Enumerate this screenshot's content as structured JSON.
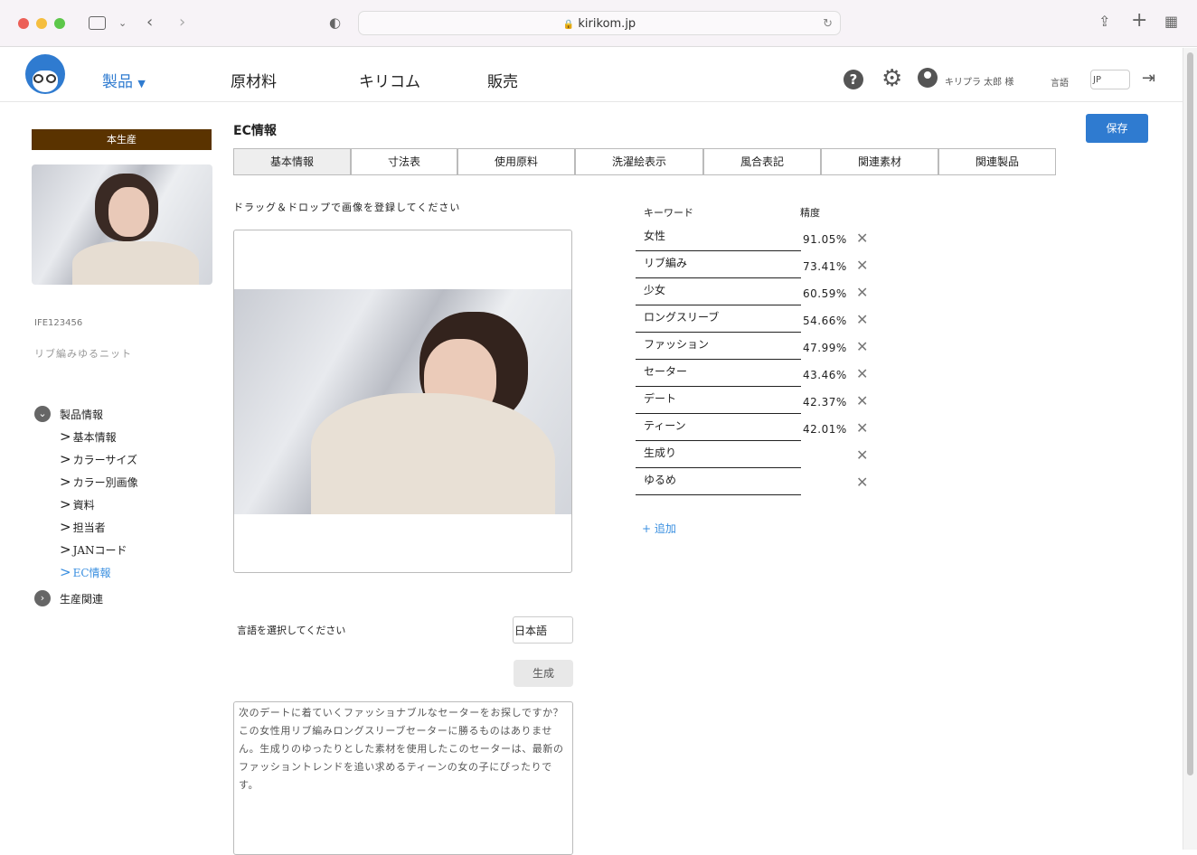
{
  "browser": {
    "url": "kirikom.jp"
  },
  "header": {
    "nav": [
      "製品",
      "原材料",
      "キリコム",
      "販売"
    ],
    "user": "キリプラ 太郎 様",
    "lang_label": "言語",
    "lang_value": "JP"
  },
  "sidebar": {
    "status": "本生産",
    "code": "IFE123456",
    "name": "リブ編みゆるニット",
    "groups": [
      {
        "label": "製品情報",
        "items": [
          "基本情報",
          "カラーサイズ",
          "カラー別画像",
          "資料",
          "担当者",
          "JANコード",
          "EC情報"
        ]
      },
      {
        "label": "生産関連"
      }
    ]
  },
  "main": {
    "title": "EC情報",
    "save": "保存",
    "tabs": [
      "基本情報",
      "寸法表",
      "使用原料",
      "洗濯絵表示",
      "風合表記",
      "関連素材",
      "関連製品"
    ],
    "drop_hint": "ドラッグ＆ドロップで画像を登録してください",
    "lang_prompt": "言語を選択してください",
    "lang_value": "日本語",
    "generate": "生成",
    "description": "次のデートに着ていくファッショナブルなセーターをお探しですか？この女性用リブ編みロングスリーブセーターに勝るものはありません。生成りのゆったりとした素材を使用したこのセーターは、最新のファッショントレンドを追い求めるティーンの女の子にぴったりです。",
    "kw_header": "キーワード",
    "acc_header": "精度",
    "keywords": [
      {
        "k": "女性",
        "p": "91.05%"
      },
      {
        "k": "リブ編み",
        "p": "73.41%"
      },
      {
        "k": "少女",
        "p": "60.59%"
      },
      {
        "k": "ロングスリーブ",
        "p": "54.66%"
      },
      {
        "k": "ファッション",
        "p": "47.99%"
      },
      {
        "k": "セーター",
        "p": "43.46%"
      },
      {
        "k": "デート",
        "p": "42.37%"
      },
      {
        "k": "ティーン",
        "p": "42.01%"
      },
      {
        "k": "生成り",
        "p": ""
      },
      {
        "k": "ゆるめ",
        "p": ""
      }
    ],
    "add": "+ 追加"
  },
  "colors": {
    "accent": "#2f7bd0",
    "status_bg": "#5a3300",
    "link": "#3a8fe0"
  }
}
